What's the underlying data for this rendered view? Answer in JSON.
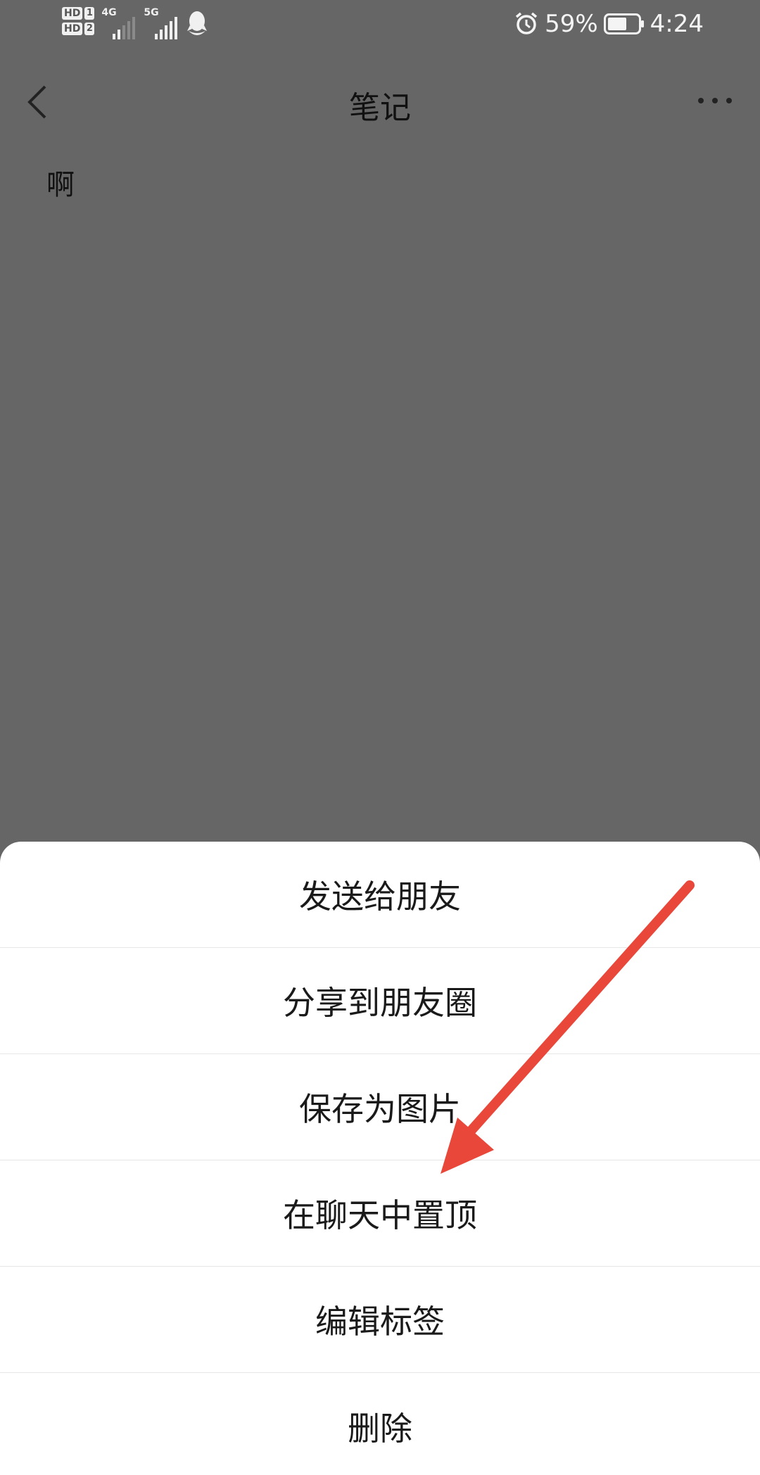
{
  "status_bar": {
    "sim1_badge": "HD",
    "sim1_num": "1",
    "sim2_badge": "HD",
    "sim2_num": "2",
    "net1": "4G",
    "net2": "5G",
    "battery_percent": "59%",
    "time": "4:24",
    "icons": [
      "alarm-icon",
      "battery-icon",
      "qq-icon",
      "signal-icon"
    ]
  },
  "nav": {
    "title": "笔记"
  },
  "note": {
    "content": "啊"
  },
  "sheet": {
    "items": [
      {
        "label": "发送给朋友"
      },
      {
        "label": "分享到朋友圈"
      },
      {
        "label": "保存为图片"
      },
      {
        "label": "在聊天中置顶"
      },
      {
        "label": "编辑标签"
      },
      {
        "label": "删除"
      }
    ]
  },
  "colors": {
    "overlay": "#666666",
    "sheet_bg": "#ffffff",
    "annotation_arrow": "#e8473a"
  }
}
